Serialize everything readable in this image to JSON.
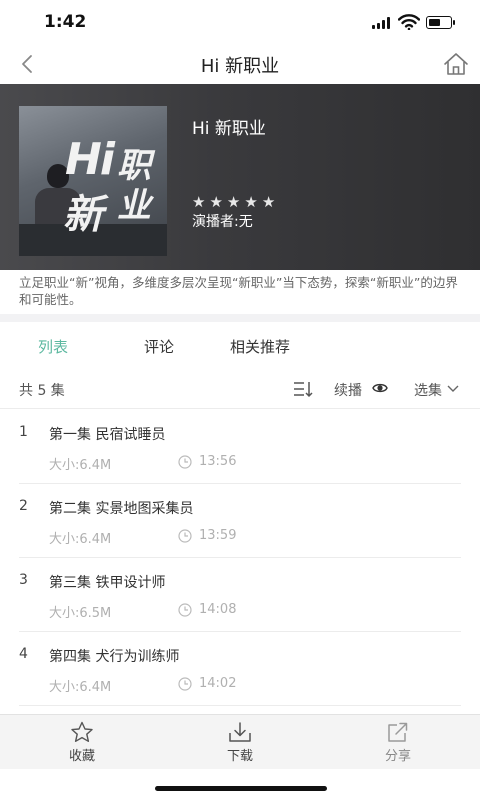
{
  "status": {
    "time": "1:42"
  },
  "nav": {
    "title": "Hi 新职业"
  },
  "hero": {
    "title": "Hi 新职业",
    "anchor": "演播者:无",
    "rating": 5,
    "cover_text_1": "Hi",
    "cover_text_2": "新",
    "cover_text_3": "职业"
  },
  "description": "立足职业“新”视角，多维度多层次呈现“新职业”当下态势，探索“新职业”的边界和可能性。",
  "tabs": [
    {
      "label": "列表",
      "active": true
    },
    {
      "label": "评论",
      "active": false
    },
    {
      "label": "相关推荐",
      "active": false
    }
  ],
  "list_header": {
    "count": "共 5 集",
    "continue": "续播",
    "select": "选集"
  },
  "episodes": [
    {
      "num": "1",
      "name": "第一集 民宿试睡员",
      "size": "大小:6.4M",
      "duration": "13:56"
    },
    {
      "num": "2",
      "name": "第二集 实景地图采集员",
      "size": "大小:6.4M",
      "duration": "13:59"
    },
    {
      "num": "3",
      "name": "第三集 铁甲设计师",
      "size": "大小:6.5M",
      "duration": "14:08"
    },
    {
      "num": "4",
      "name": "第四集 犬行为训练师",
      "size": "大小:6.4M",
      "duration": "14:02"
    }
  ],
  "toolbar": {
    "favorite": "收藏",
    "download": "下载",
    "share": "分享"
  },
  "colors": {
    "accent": "#5cb8a0"
  }
}
